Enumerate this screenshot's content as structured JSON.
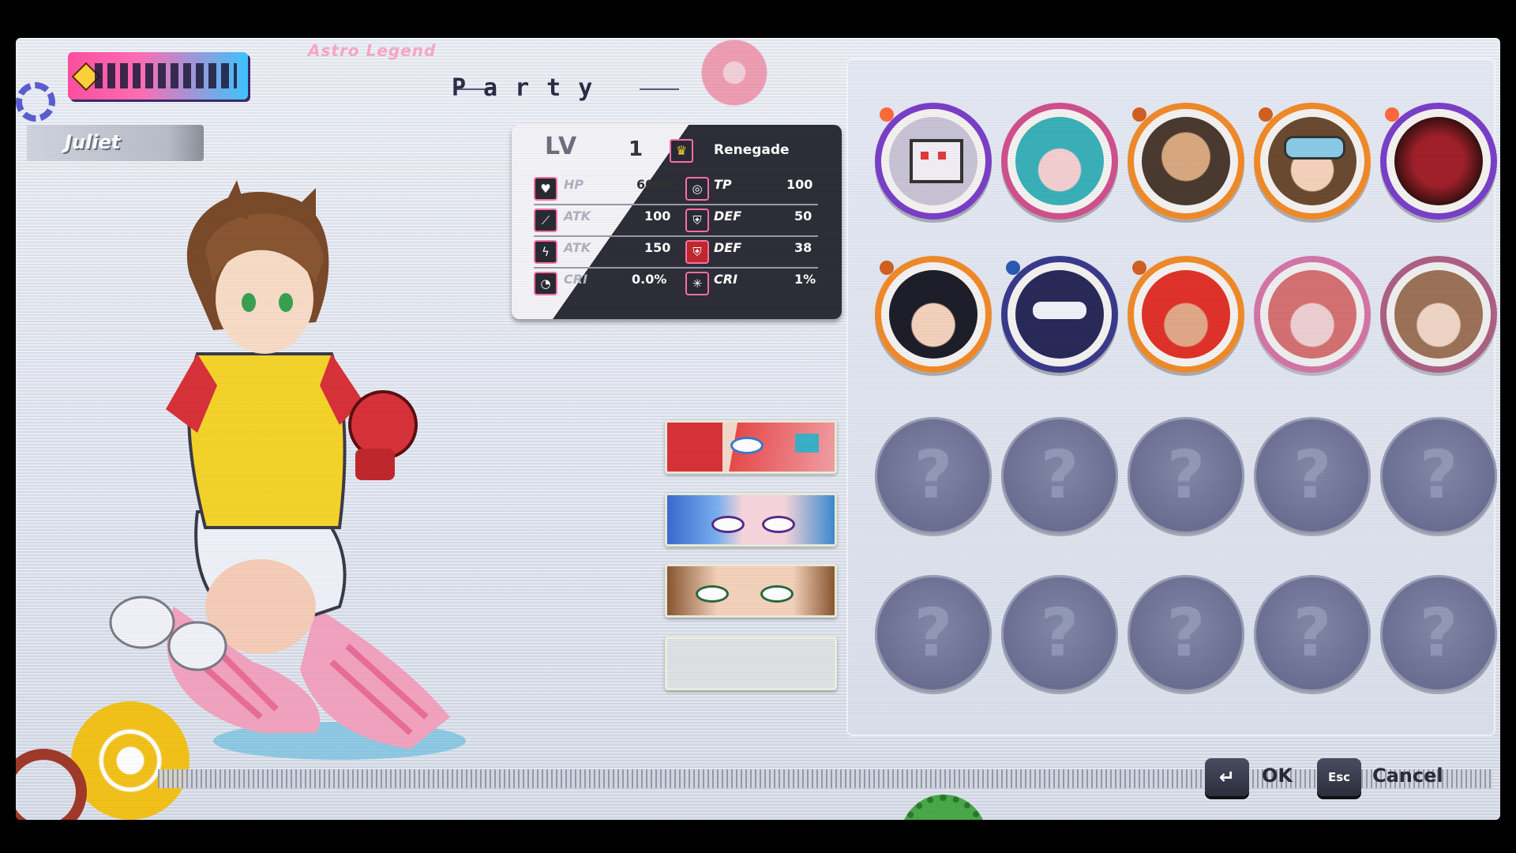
{
  "header": {
    "game_subtitle": "Astro Legend",
    "screen_title": "Party"
  },
  "character": {
    "name": "Juliet"
  },
  "stats": {
    "level_label": "LV",
    "level": "1",
    "class_name": "Renegade",
    "rows": [
      {
        "left": {
          "icon": "heart-icon",
          "label": "HP",
          "value": "6000"
        },
        "right": {
          "icon": "tp-icon",
          "label": "TP",
          "value": "100"
        }
      },
      {
        "left": {
          "icon": "sword-icon",
          "label": "ATK",
          "value": "100"
        },
        "right": {
          "icon": "shield-icon",
          "label": "DEF",
          "value": "50"
        }
      },
      {
        "left": {
          "icon": "lightning-icon",
          "label": "ATK",
          "value": "150"
        },
        "right": {
          "icon": "magic-shield-icon",
          "label": "DEF",
          "value": "38"
        }
      },
      {
        "left": {
          "icon": "crit-gauge-icon",
          "label": "CRI",
          "value": "0.0%"
        },
        "right": {
          "icon": "crit-star-icon",
          "label": "CRI",
          "value": "1%"
        }
      }
    ]
  },
  "party_slots": [
    {
      "member": "red-haired-hero"
    },
    {
      "member": "blue-haired-girl"
    },
    {
      "member": "juliet"
    },
    {
      "member": "empty"
    }
  ],
  "roster": [
    {
      "type": "robot",
      "ring": "#7a3fc8",
      "knob": "#ff6a3a",
      "unlocked": true
    },
    {
      "type": "teal-haired-girl",
      "ring": "#d0508e",
      "knob": "#a03a70",
      "unlocked": true
    },
    {
      "type": "bald-monk",
      "ring": "#f08a2a",
      "knob": "#d06020",
      "unlocked": true
    },
    {
      "type": "goggles-boy",
      "ring": "#f08a2a",
      "knob": "#d06020",
      "unlocked": true
    },
    {
      "type": "red-armor",
      "ring": "#7a3fc8",
      "knob": "#ff6a3a",
      "unlocked": true
    },
    {
      "type": "dark-haired-boy",
      "ring": "#f08a2a",
      "knob": "#d06020",
      "unlocked": true
    },
    {
      "type": "masked-ninja",
      "ring": "#3a3a8c",
      "knob": "#2a5ab0",
      "unlocked": true
    },
    {
      "type": "red-haired-fighter",
      "ring": "#f08a2a",
      "knob": "#d06020",
      "unlocked": true
    },
    {
      "type": "red-haired-girl",
      "ring": "#d0508e",
      "knob": "#a03a70",
      "unlocked": true
    },
    {
      "type": "cat-girl",
      "ring": "#a0406a",
      "knob": "#a03a70",
      "unlocked": true
    },
    {
      "type": "locked",
      "glyph": "?"
    },
    {
      "type": "locked",
      "glyph": "?"
    },
    {
      "type": "locked",
      "glyph": "?"
    },
    {
      "type": "locked",
      "glyph": "?"
    },
    {
      "type": "locked",
      "glyph": "?"
    },
    {
      "type": "locked",
      "glyph": "?"
    },
    {
      "type": "locked",
      "glyph": "?"
    },
    {
      "type": "locked",
      "glyph": "?"
    },
    {
      "type": "locked",
      "glyph": "?"
    },
    {
      "type": "locked",
      "glyph": "?"
    }
  ],
  "controls": {
    "ok_key": "↵",
    "ok_label": "OK",
    "cancel_key": "Esc",
    "cancel_label": "Cancel"
  },
  "colors": {
    "accent_pink": "#ff6fa8",
    "panel_dark": "#2e2e38",
    "gear_yellow": "#f2c21a"
  }
}
